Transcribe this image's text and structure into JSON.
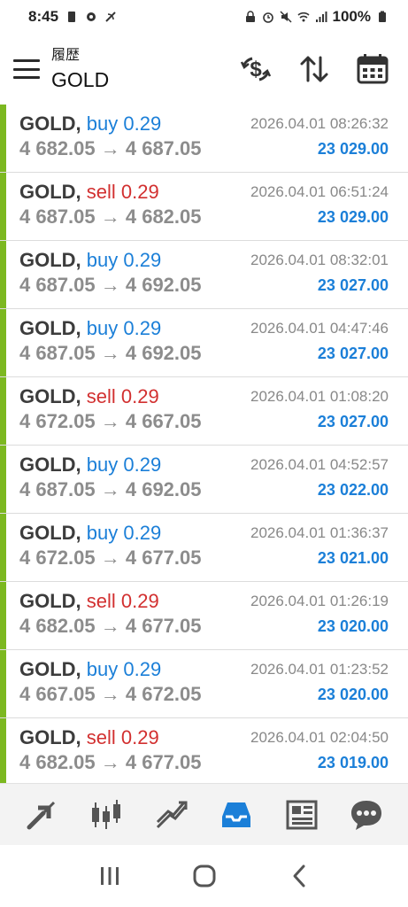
{
  "status_bar": {
    "time": "8:45",
    "battery": "100%"
  },
  "header": {
    "subtitle": "履歴",
    "title": "GOLD"
  },
  "deals": [
    {
      "symbol": "GOLD,",
      "side": "buy",
      "side_text": "buy 0.29",
      "time": "2026.04.01 08:26:32",
      "prices": "4 682.05 → 4 687.05",
      "value": "23 029.00"
    },
    {
      "symbol": "GOLD,",
      "side": "sell",
      "side_text": "sell 0.29",
      "time": "2026.04.01 06:51:24",
      "prices": "4 687.05 → 4 682.05",
      "value": "23 029.00"
    },
    {
      "symbol": "GOLD,",
      "side": "buy",
      "side_text": "buy 0.29",
      "time": "2026.04.01 08:32:01",
      "prices": "4 687.05 → 4 692.05",
      "value": "23 027.00"
    },
    {
      "symbol": "GOLD,",
      "side": "buy",
      "side_text": "buy 0.29",
      "time": "2026.04.01 04:47:46",
      "prices": "4 687.05 → 4 692.05",
      "value": "23 027.00"
    },
    {
      "symbol": "GOLD,",
      "side": "sell",
      "side_text": "sell 0.29",
      "time": "2026.04.01 01:08:20",
      "prices": "4 672.05 → 4 667.05",
      "value": "23 027.00"
    },
    {
      "symbol": "GOLD,",
      "side": "buy",
      "side_text": "buy 0.29",
      "time": "2026.04.01 04:52:57",
      "prices": "4 687.05 → 4 692.05",
      "value": "23 022.00"
    },
    {
      "symbol": "GOLD,",
      "side": "buy",
      "side_text": "buy 0.29",
      "time": "2026.04.01 01:36:37",
      "prices": "4 672.05 → 4 677.05",
      "value": "23 021.00"
    },
    {
      "symbol": "GOLD,",
      "side": "sell",
      "side_text": "sell 0.29",
      "time": "2026.04.01 01:26:19",
      "prices": "4 682.05 → 4 677.05",
      "value": "23 020.00"
    },
    {
      "symbol": "GOLD,",
      "side": "buy",
      "side_text": "buy 0.29",
      "time": "2026.04.01 01:23:52",
      "prices": "4 667.05 → 4 672.05",
      "value": "23 020.00"
    },
    {
      "symbol": "GOLD,",
      "side": "sell",
      "side_text": "sell 0.29",
      "time": "2026.04.01 02:04:50",
      "prices": "4 682.05 → 4 677.05",
      "value": "23 019.00"
    }
  ],
  "colors": {
    "buy": "#1b7fd8",
    "sell": "#d23030",
    "profit": "#1b7fd8",
    "row_bar": "#7cb820",
    "active_nav": "#1b7fd8"
  },
  "bottom_nav": [
    {
      "icon": "trade-arrows-icon",
      "active": false
    },
    {
      "icon": "candlestick-chart-icon",
      "active": false
    },
    {
      "icon": "trend-chart-icon",
      "active": false
    },
    {
      "icon": "history-inbox-icon",
      "active": true
    },
    {
      "icon": "news-icon",
      "active": false
    },
    {
      "icon": "chat-bubble-icon",
      "active": false
    }
  ]
}
